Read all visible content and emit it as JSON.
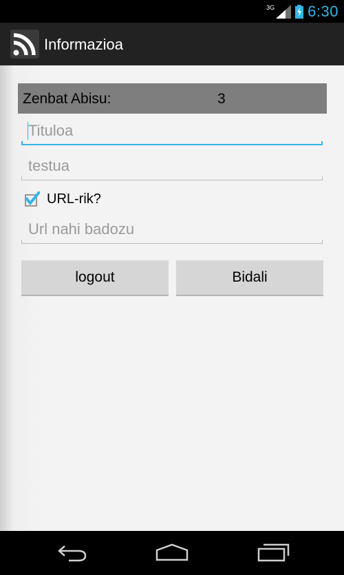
{
  "status_bar": {
    "network": "3G",
    "time": "6:30",
    "icons": [
      "signal-icon",
      "battery-icon"
    ]
  },
  "action_bar": {
    "title": "Informazioa",
    "icon": "rss-icon"
  },
  "count": {
    "label": "Zenbat Abisu:",
    "value": "3"
  },
  "form": {
    "title_placeholder": "Tituloa",
    "text_placeholder": "testua",
    "url_checkbox_label": "URL-rik?",
    "url_checkbox_checked": true,
    "url_placeholder": "Url nahi badozu"
  },
  "buttons": {
    "logout": "logout",
    "send": "Bidali"
  },
  "nav_bar": {
    "icons": [
      "back-icon",
      "home-icon",
      "recent-apps-icon"
    ]
  },
  "colors": {
    "accent": "#33b5e5",
    "count_bar": "#7e7e7e",
    "button": "#d6d6d6"
  }
}
